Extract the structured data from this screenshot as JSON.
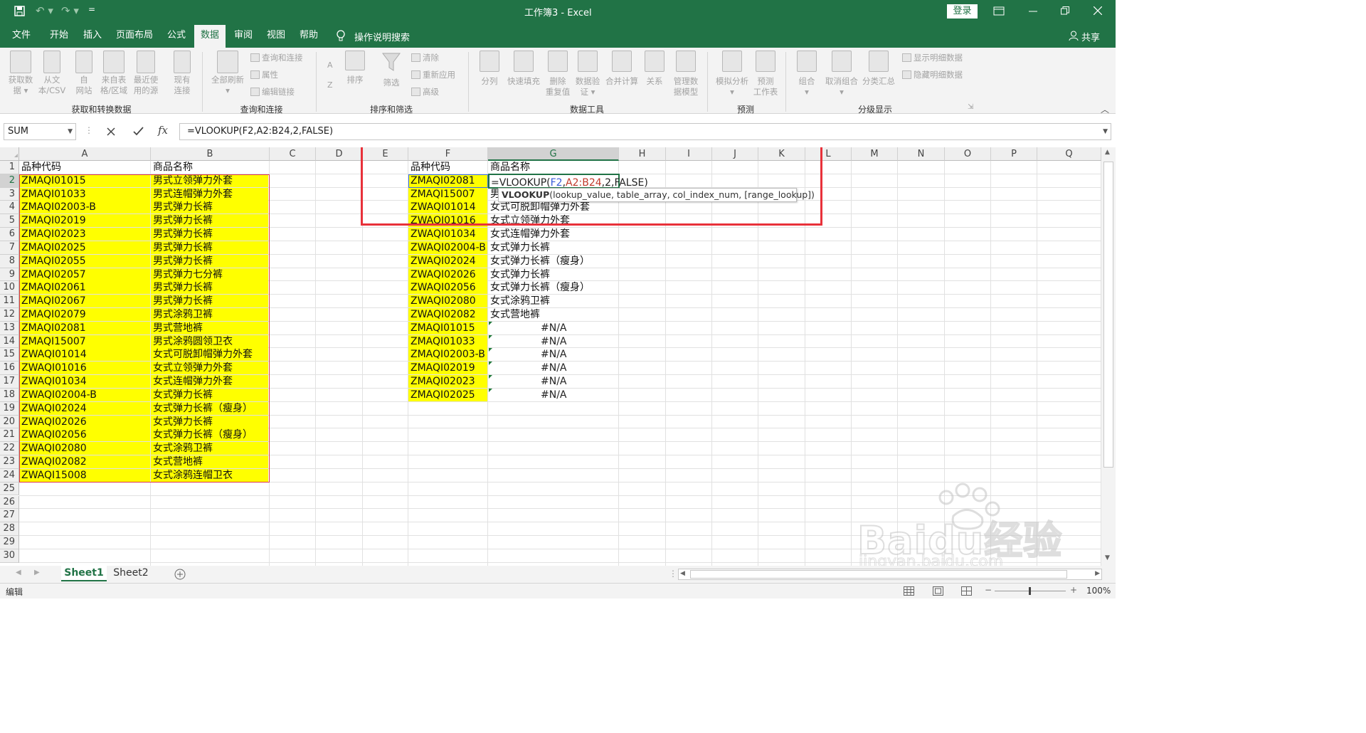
{
  "title_bar": {
    "window_title": "工作簿3  -  Excel",
    "login_label": "登录",
    "qat_more": "="
  },
  "tabs": [
    "文件",
    "开始",
    "插入",
    "页面布局",
    "公式",
    "数据",
    "审阅",
    "视图",
    "帮助"
  ],
  "active_tab": "数据",
  "tell_me": "操作说明搜索",
  "share_label": "共享",
  "ribbon": {
    "groups": [
      {
        "label": "获取和转换数据",
        "buttons": [
          "获取数\n据 ▾",
          "从文\n本/CSV",
          "自\n网站",
          "来自表\n格/区域",
          "最近使\n用的源",
          "现有\n连接"
        ]
      },
      {
        "label": "查询和连接",
        "buttons": [
          "全部刷新\n▾"
        ],
        "small": [
          "查询和连接",
          "属性",
          "编辑链接"
        ]
      },
      {
        "label": "排序和筛选",
        "buttons": [
          "排序",
          "筛选"
        ],
        "small": [
          "清除",
          "重新应用",
          "高级"
        ]
      },
      {
        "label": "数据工具",
        "buttons": [
          "分列",
          "快速填充",
          "删除\n重复值",
          "数据验\n证 ▾",
          "合并计算",
          "关系",
          "管理数\n据模型"
        ]
      },
      {
        "label": "预测",
        "buttons": [
          "模拟分析\n▾",
          "预测\n工作表"
        ]
      },
      {
        "label": "分级显示",
        "buttons": [
          "组合\n▾",
          "取消组合\n▾",
          "分类汇总"
        ],
        "small": [
          "显示明细数据",
          "隐藏明细数据"
        ]
      }
    ]
  },
  "formula_bar": {
    "name_box": "SUM",
    "formula": "=VLOOKUP(F2,A2:B24,2,FALSE)",
    "fx": "fx"
  },
  "columns": [
    "A",
    "B",
    "C",
    "D",
    "E",
    "F",
    "G",
    "H",
    "I",
    "J",
    "K",
    "L",
    "M",
    "N",
    "O",
    "P",
    "Q"
  ],
  "rows": [
    "1",
    "2",
    "3",
    "4",
    "5",
    "6",
    "7",
    "8",
    "9",
    "10",
    "11",
    "12",
    "13",
    "14",
    "15",
    "16",
    "17",
    "18",
    "19",
    "20",
    "21",
    "22",
    "23",
    "24",
    "25",
    "26",
    "27",
    "28",
    "29",
    "30"
  ],
  "source_table": {
    "headers": [
      "品种代码",
      "商品名称"
    ],
    "rows": [
      [
        "ZMAQI01015",
        "男式立领弹力外套"
      ],
      [
        "ZMAQI01033",
        "男式连帽弹力外套"
      ],
      [
        "ZMAQI02003-B",
        "男式弹力长裤"
      ],
      [
        "ZMAQI02019",
        "男式弹力长裤"
      ],
      [
        "ZMAQI02023",
        "男式弹力长裤"
      ],
      [
        "ZMAQI02025",
        "男式弹力长裤"
      ],
      [
        "ZMAQI02055",
        "男式弹力长裤"
      ],
      [
        "ZMAQI02057",
        "男式弹力七分裤"
      ],
      [
        "ZMAQI02061",
        "男式弹力长裤"
      ],
      [
        "ZMAQI02067",
        "男式弹力长裤"
      ],
      [
        "ZMAQI02079",
        "男式涂鸦卫裤"
      ],
      [
        "ZMAQI02081",
        "男式营地裤"
      ],
      [
        "ZMAQI15007",
        "男式涂鸦圆领卫衣"
      ],
      [
        "ZWAQI01014",
        "女式可脱卸帽弹力外套"
      ],
      [
        "ZWAQI01016",
        "女式立领弹力外套"
      ],
      [
        "ZWAQI01034",
        "女式连帽弹力外套"
      ],
      [
        "ZWAQI02004-B",
        "女式弹力长裤"
      ],
      [
        "ZWAQI02024",
        "女式弹力长裤（瘦身）"
      ],
      [
        "ZWAQI02026",
        "女式弹力长裤"
      ],
      [
        "ZWAQI02056",
        "女式弹力长裤（瘦身）"
      ],
      [
        "ZWAQI02080",
        "女式涂鸦卫裤"
      ],
      [
        "ZWAQI02082",
        "女式营地裤"
      ],
      [
        "ZWAQI15008",
        "女式涂鸦连帽卫衣"
      ]
    ]
  },
  "lookup_table": {
    "headers": [
      "品种代码",
      "商品名称"
    ],
    "editing_formula_parts": [
      "=VLOOKUP(",
      "F2",
      ",",
      "A2:B24",
      ",2,FALSE)"
    ],
    "rows": [
      [
        "ZMAQI02081",
        ""
      ],
      [
        "ZMAQI15007",
        "男"
      ],
      [
        "ZWAQI01014",
        "女式可脱卸帽弹力外套"
      ],
      [
        "ZWAQI01016",
        "女式立领弹力外套"
      ],
      [
        "ZWAQI01034",
        "女式连帽弹力外套"
      ],
      [
        "ZWAQI02004-B",
        "女式弹力长裤"
      ],
      [
        "ZWAQI02024",
        "女式弹力长裤（瘦身）"
      ],
      [
        "ZWAQI02026",
        "女式弹力长裤"
      ],
      [
        "ZWAQI02056",
        "女式弹力长裤（瘦身）"
      ],
      [
        "ZWAQI02080",
        "女式涂鸦卫裤"
      ],
      [
        "ZWAQI02082",
        "女式营地裤"
      ],
      [
        "ZMAQI01015",
        "#N/A"
      ],
      [
        "ZMAQI01033",
        "#N/A"
      ],
      [
        "ZMAQI02003-B",
        "#N/A"
      ],
      [
        "ZMAQI02019",
        "#N/A"
      ],
      [
        "ZMAQI02023",
        "#N/A"
      ],
      [
        "ZMAQI02025",
        "#N/A"
      ]
    ]
  },
  "tooltip": {
    "func": "VLOOKUP",
    "args": "(lookup_value, table_array, col_index_num, [range_lookup])"
  },
  "sheets": [
    "Sheet1",
    "Sheet2"
  ],
  "active_sheet": "Sheet1",
  "status": {
    "mode": "编辑",
    "zoom": "100%"
  },
  "watermark": {
    "main": "Baidu经验",
    "url": "jingyan.baidu.com"
  },
  "colors": {
    "excel_green": "#217346",
    "highlight_yellow": "#ffff00",
    "annotation_red": "#e8313a",
    "ref_blue": "#3a5bd9",
    "ref_red": "#c0392b"
  }
}
